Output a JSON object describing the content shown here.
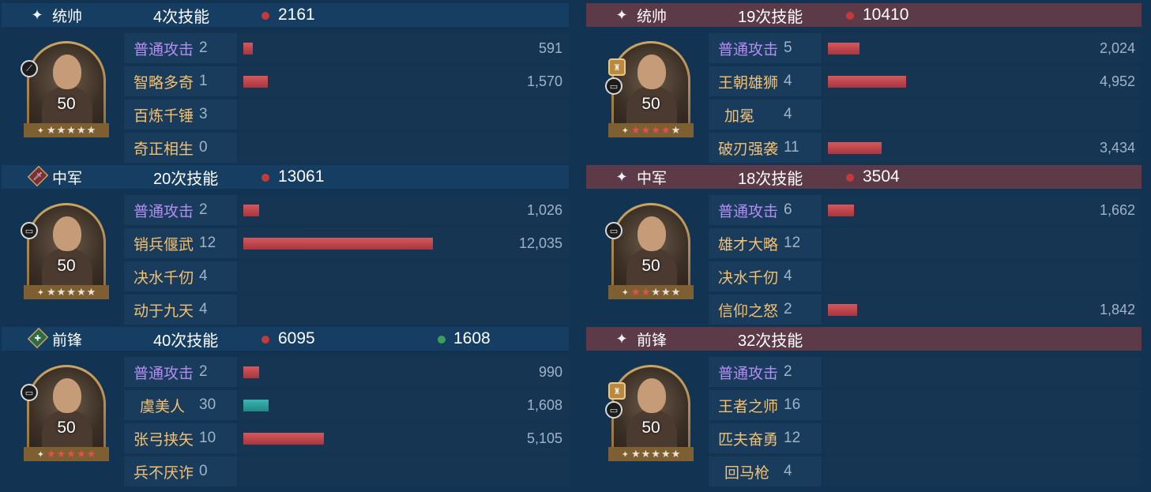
{
  "left": [
    {
      "role": "统帅",
      "casts": "4次技能",
      "damage": "2161",
      "heal": "",
      "level": "50",
      "stars": [
        "gold",
        "gold",
        "gold",
        "gold",
        "gold"
      ],
      "skills": [
        {
          "name": "普通攻击",
          "count": "2",
          "value": "591",
          "bar": 591,
          "type": "atk"
        },
        {
          "name": "智略多奇",
          "count": "1",
          "value": "1,570",
          "bar": 1570,
          "type": "norm"
        },
        {
          "name": "百炼千锤",
          "count": "3",
          "value": "",
          "bar": 0,
          "type": "norm"
        },
        {
          "name": "奇正相生",
          "count": "0",
          "value": "",
          "bar": 0,
          "type": "norm"
        }
      ]
    },
    {
      "role": "中军",
      "casts": "20次技能",
      "damage": "13061",
      "heal": "",
      "level": "50",
      "stars": [
        "gold",
        "gold",
        "gold",
        "gold",
        "gold"
      ],
      "skills": [
        {
          "name": "普通攻击",
          "count": "2",
          "value": "1,026",
          "bar": 1026,
          "type": "atk"
        },
        {
          "name": "销兵偃武",
          "count": "12",
          "value": "12,035",
          "bar": 12035,
          "type": "norm"
        },
        {
          "name": "决水千仞",
          "count": "4",
          "value": "",
          "bar": 0,
          "type": "norm"
        },
        {
          "name": "动于九天",
          "count": "4",
          "value": "",
          "bar": 0,
          "type": "norm"
        }
      ]
    },
    {
      "role": "前锋",
      "casts": "40次技能",
      "damage": "6095",
      "heal": "1608",
      "level": "50",
      "stars": [
        "red",
        "red",
        "red",
        "red",
        "red"
      ],
      "skills": [
        {
          "name": "普通攻击",
          "count": "2",
          "value": "990",
          "bar": 990,
          "type": "atk"
        },
        {
          "name": "虞美人",
          "count": "30",
          "value": "1,608",
          "bar": 1608,
          "type": "norm",
          "teal": true
        },
        {
          "name": "张弓挟矢",
          "count": "10",
          "value": "5,105",
          "bar": 5105,
          "type": "norm"
        },
        {
          "name": "兵不厌诈",
          "count": "0",
          "value": "",
          "bar": 0,
          "type": "norm"
        }
      ]
    }
  ],
  "right": [
    {
      "role": "统帅",
      "casts": "19次技能",
      "damage": "10410",
      "heal": "",
      "level": "50",
      "stars": [
        "red",
        "red",
        "red",
        "red",
        "gold"
      ],
      "skills": [
        {
          "name": "普通攻击",
          "count": "5",
          "value": "2,024",
          "bar": 2024,
          "type": "atk"
        },
        {
          "name": "王朝雄狮",
          "count": "4",
          "value": "4,952",
          "bar": 4952,
          "type": "norm"
        },
        {
          "name": "加冕",
          "count": "4",
          "value": "",
          "bar": 0,
          "type": "norm"
        },
        {
          "name": "破刃强袭",
          "count": "11",
          "value": "3,434",
          "bar": 3434,
          "type": "norm"
        }
      ]
    },
    {
      "role": "中军",
      "casts": "18次技能",
      "damage": "3504",
      "heal": "",
      "level": "50",
      "stars": [
        "red",
        "red",
        "gold",
        "gold",
        "gold"
      ],
      "skills": [
        {
          "name": "普通攻击",
          "count": "6",
          "value": "1,662",
          "bar": 1662,
          "type": "atk"
        },
        {
          "name": "雄才大略",
          "count": "12",
          "value": "",
          "bar": 0,
          "type": "norm"
        },
        {
          "name": "决水千仞",
          "count": "4",
          "value": "",
          "bar": 0,
          "type": "norm"
        },
        {
          "name": "信仰之怒",
          "count": "2",
          "value": "1,842",
          "bar": 1842,
          "type": "norm"
        }
      ]
    },
    {
      "role": "前锋",
      "casts": "32次技能",
      "damage": "",
      "heal": "",
      "level": "50",
      "stars": [
        "gold",
        "gold",
        "gold",
        "gold",
        "gold"
      ],
      "skills": [
        {
          "name": "普通攻击",
          "count": "2",
          "value": "",
          "bar": 0,
          "type": "atk"
        },
        {
          "name": "王者之师",
          "count": "16",
          "value": "",
          "bar": 0,
          "type": "norm"
        },
        {
          "name": "匹夫奋勇",
          "count": "12",
          "value": "",
          "bar": 0,
          "type": "norm"
        },
        {
          "name": "回马枪",
          "count": "4",
          "value": "",
          "bar": 0,
          "type": "norm"
        }
      ]
    }
  ],
  "icons": {
    "role_plain": "sparkle-icon",
    "role_mid_left": "sword-badge-icon",
    "role_front_left": "heal-badge-icon"
  },
  "colors": {
    "left_header": "#153e62",
    "right_header": "#5d3a48",
    "damage_dot": "#c43a3a",
    "heal_dot": "#3aa05a",
    "damage_bar": "#c2444b",
    "heal_bar": "#2aa3a0",
    "attack_label": "#b48cf3",
    "skill_label": "#f3c070"
  }
}
